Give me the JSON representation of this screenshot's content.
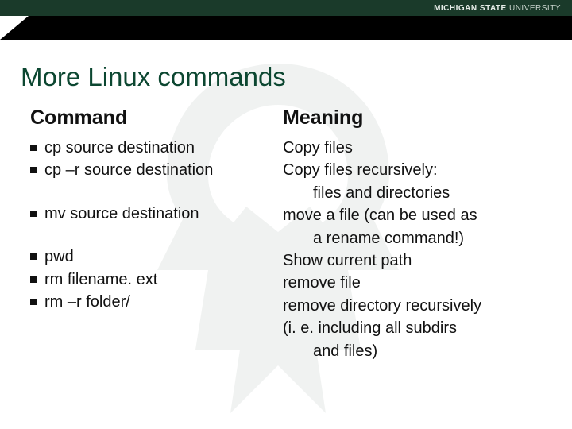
{
  "brand": {
    "bold": "MICHIGAN STATE",
    "light": " UNIVERSITY"
  },
  "title": "More Linux commands",
  "headers": {
    "command": "Command",
    "meaning": "Meaning"
  },
  "rows": [
    {
      "cmd": "cp source destination",
      "mean": [
        "Copy files"
      ]
    },
    {
      "cmd": "cp –r source destination",
      "mean": [
        "Copy files recursively:",
        "files and directories"
      ]
    },
    {
      "cmd": "",
      "mean": []
    },
    {
      "cmd": "mv source destination",
      "mean": [
        "move a file (can be used as",
        "a rename command!)"
      ]
    },
    {
      "cmd": "",
      "mean": []
    },
    {
      "cmd": "pwd",
      "mean": [
        "Show current path"
      ]
    },
    {
      "cmd": "rm filename. ext",
      "mean": [
        "remove file"
      ]
    },
    {
      "cmd": "rm –r folder/",
      "mean": [
        "remove directory recursively",
        "(i. e. including all subdirs",
        "and files)"
      ]
    }
  ]
}
